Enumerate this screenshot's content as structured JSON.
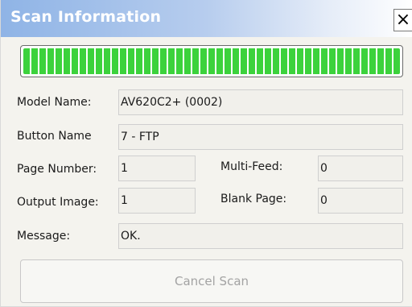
{
  "window": {
    "title": "Scan Information",
    "close_glyph": "×"
  },
  "progress": {
    "fraction": 1.0,
    "color": "#3cd23c"
  },
  "fields": {
    "model_name": {
      "label": "Model Name:",
      "value": "AV620C2+ (0002)"
    },
    "button_name": {
      "label": "Button Name",
      "value": "7 - FTP"
    },
    "page_number": {
      "label": "Page Number:",
      "value": "1"
    },
    "multi_feed": {
      "label": "Multi-Feed:",
      "value": "0"
    },
    "output_image": {
      "label": "Output Image:",
      "value": "1"
    },
    "blank_page": {
      "label": "Blank Page:",
      "value": "0"
    },
    "message": {
      "label": "Message:",
      "value": "OK."
    }
  },
  "buttons": {
    "cancel_label": "Cancel Scan"
  }
}
